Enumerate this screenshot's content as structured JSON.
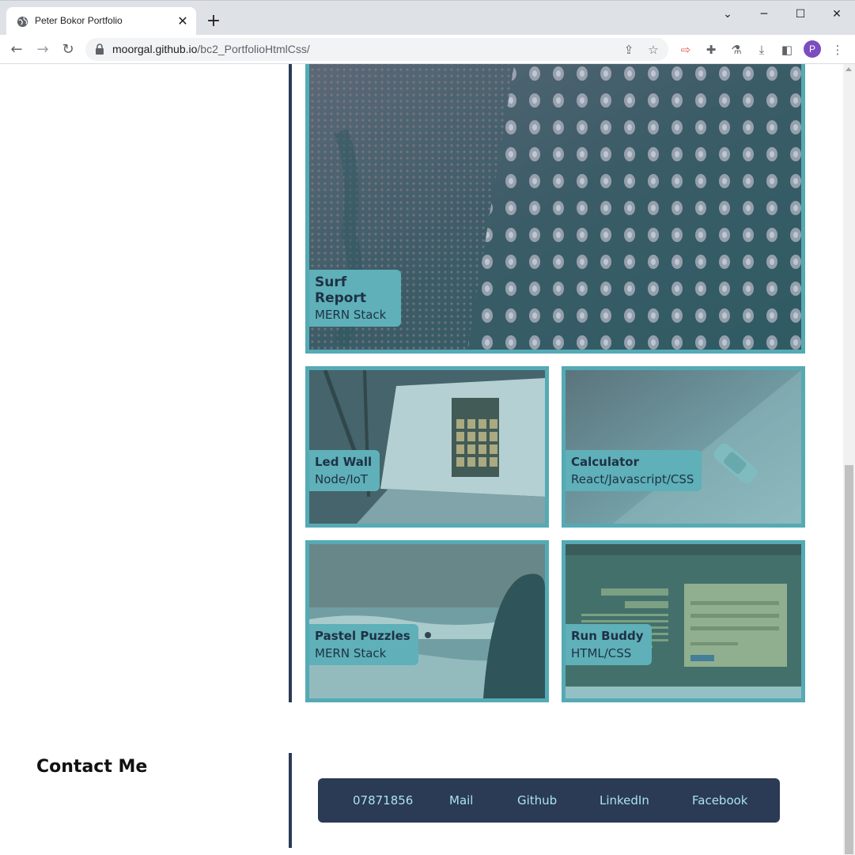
{
  "browser": {
    "tab_title": "Peter Bokor Portfolio",
    "url_host": "moorgal.github.io",
    "url_path": "/bc2_PortfolioHtmlCss/",
    "profile_initial": "P"
  },
  "projects": [
    {
      "title": "Surf Report",
      "stack": "MERN Stack"
    },
    {
      "title": "Led Wall",
      "stack": "Node/IoT"
    },
    {
      "title": "Calculator",
      "stack": "React/Javascript/CSS"
    },
    {
      "title": "Pastel Puzzles",
      "stack": "MERN Stack"
    },
    {
      "title": "Run Buddy",
      "stack": "HTML/CSS"
    }
  ],
  "contact": {
    "heading": "Contact Me",
    "links": [
      "07871856",
      "Mail",
      "Github",
      "LinkedIn",
      "Facebook"
    ]
  },
  "colors": {
    "navy": "#2b3a55",
    "teal": "#55aab4",
    "link": "#a9e4ec"
  }
}
